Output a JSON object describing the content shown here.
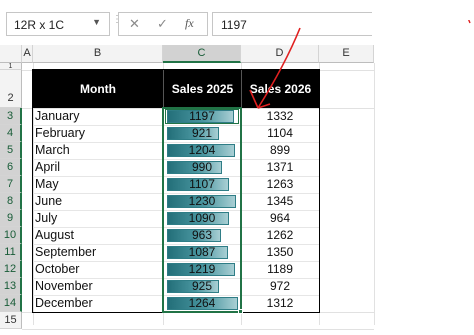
{
  "formula_bar": {
    "name_box": "12R x 1C",
    "cancel_glyph": "✕",
    "enter_glyph": "✓",
    "fx_label": "fx",
    "formula": "1197"
  },
  "columns": [
    "A",
    "B",
    "C",
    "D",
    "E"
  ],
  "row_numbers": [
    "1",
    "2",
    "3",
    "4",
    "5",
    "6",
    "7",
    "8",
    "9",
    "10",
    "11",
    "12",
    "13",
    "14",
    "15"
  ],
  "table": {
    "headers": [
      "Month",
      "Sales 2025",
      "Sales 2026"
    ],
    "rows": [
      {
        "month": "January",
        "sales_2025": "1197",
        "sales_2026": "1332",
        "bar_fill": 0.88
      },
      {
        "month": "February",
        "sales_2025": "921",
        "sales_2026": "1104",
        "bar_fill": 0.68
      },
      {
        "month": "March",
        "sales_2025": "1204",
        "sales_2026": "899",
        "bar_fill": 0.89
      },
      {
        "month": "April",
        "sales_2025": "990",
        "sales_2026": "1371",
        "bar_fill": 0.73
      },
      {
        "month": "May",
        "sales_2025": "1107",
        "sales_2026": "1263",
        "bar_fill": 0.82
      },
      {
        "month": "June",
        "sales_2025": "1230",
        "sales_2026": "1345",
        "bar_fill": 0.91
      },
      {
        "month": "July",
        "sales_2025": "1090",
        "sales_2026": "964",
        "bar_fill": 0.81
      },
      {
        "month": "August",
        "sales_2025": "963",
        "sales_2026": "1262",
        "bar_fill": 0.71
      },
      {
        "month": "September",
        "sales_2025": "1087",
        "sales_2026": "1350",
        "bar_fill": 0.8
      },
      {
        "month": "October",
        "sales_2025": "1219",
        "sales_2026": "1189",
        "bar_fill": 0.9
      },
      {
        "month": "November",
        "sales_2025": "925",
        "sales_2026": "972",
        "bar_fill": 0.68
      },
      {
        "month": "December",
        "sales_2025": "1264",
        "sales_2026": "1312",
        "bar_fill": 0.94
      }
    ]
  },
  "colors": {
    "accent_green": "#217346",
    "header_fill": "#000000",
    "databar": "#2f7d86",
    "annotation": "#e02020"
  },
  "icons": [
    "chevron-down-icon",
    "cancel-icon",
    "enter-icon",
    "fx-icon",
    "arrow-annotation-icon"
  ]
}
